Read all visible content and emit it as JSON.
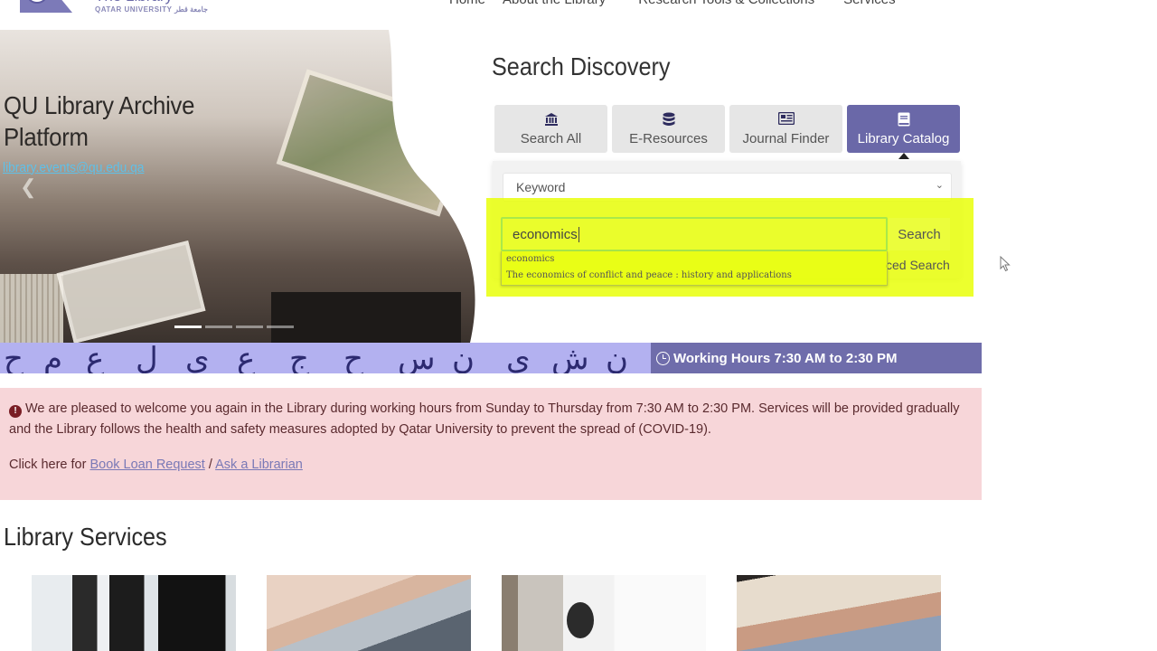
{
  "header": {
    "logo": {
      "title": "The Library",
      "subtitle": "QATAR UNIVERSITY جامعة قطر"
    },
    "nav": [
      {
        "label": "Home"
      },
      {
        "label": "About the Library"
      },
      {
        "label": "Research Tools & Collections"
      },
      {
        "label": "Services"
      }
    ]
  },
  "hero": {
    "title_line1": "QU Library Archive",
    "title_line2": "Platform",
    "email": "library.events@qu.edu.qa",
    "prev_icon": "chevron-left-icon",
    "slides_total": 4,
    "active_slide": 1
  },
  "search_discovery": {
    "title": "Search Discovery",
    "tabs": [
      {
        "label": "Search All",
        "icon": "institution-icon",
        "active": false
      },
      {
        "label": "E-Resources",
        "icon": "database-icon",
        "active": false
      },
      {
        "label": "Journal Finder",
        "icon": "newspaper-icon",
        "active": false
      },
      {
        "label": "Library Catalog",
        "icon": "book-icon",
        "active": true
      }
    ],
    "search_type": {
      "selected": "Keyword"
    },
    "query": {
      "value": "economics"
    },
    "search_button": "Search",
    "advanced_search": "ced Search",
    "autocomplete": [
      "economics",
      "The economics of conflict and peace : history and applications"
    ]
  },
  "working_hours": {
    "text": "Working Hours 7:30 AM to 2:30 PM"
  },
  "alert": {
    "message": "We are pleased to welcome you again in the Library during working hours from Sunday to Thursday from 7:30 AM to 2:30 PM. Services will be provided gradually and the Library follows the health and safety measures adopted by Qatar University to prevent the spread of (COVID-19).",
    "links_prefix": "Click here for",
    "link1": "Book Loan Request",
    "separator": "/",
    "link2": "Ask a Librarian"
  },
  "library_services": {
    "title": "Library Services",
    "cards": 4
  },
  "colors": {
    "brand_purple": "#6a68a8",
    "highlight_yellow": "#e8ff00",
    "alert_bg": "#f7d6d9",
    "link": "#7a79b6"
  }
}
